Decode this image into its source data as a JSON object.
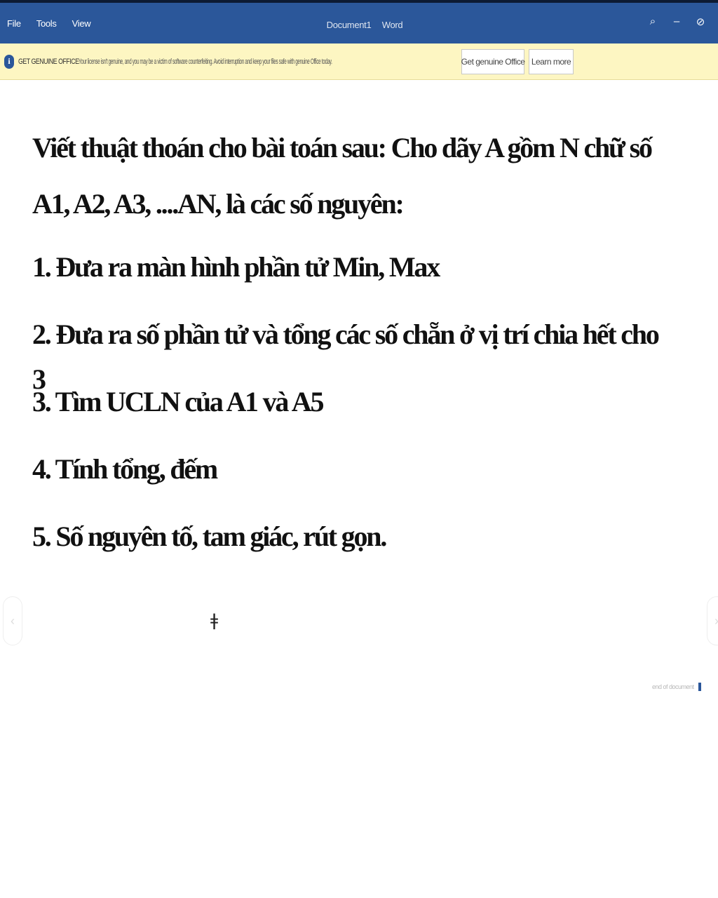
{
  "titlebar": {
    "menu": [
      "File",
      "Tools",
      "View"
    ],
    "doc_name": "Document1",
    "app_name": "Word",
    "controls": {
      "search": "⌕",
      "minimize": "–",
      "close": "⊘"
    }
  },
  "infobar": {
    "icon": "i",
    "heading": "GET GENUINE OFFICE",
    "message": "Your license isn't genuine, and you may be a victim of software counterfeiting. Avoid interruption and keep your files safe with genuine Office today.",
    "btn_genuine": "Get genuine Office",
    "btn_learn": "Learn more"
  },
  "document": {
    "heading": "Viết thuật thoán cho bài toán sau: Cho dãy A gồm N chữ số A1, A2, A3, ....AN, là các số nguyên:",
    "items": [
      "1. Đưa ra màn hình phần tử Min, Max",
      "2. Đưa ra số phần tử và tổng các số chẵn ở vị trí chia hết cho 3",
      "3. Tìm UCLN của A1 và A5",
      "4. Tính tổng, đếm",
      "5. Số nguyên tố, tam giác, rút gọn."
    ],
    "page_indicator": "end of document"
  },
  "colors": {
    "titlebar": "#2b579a",
    "infobar": "#fdf6c2"
  }
}
